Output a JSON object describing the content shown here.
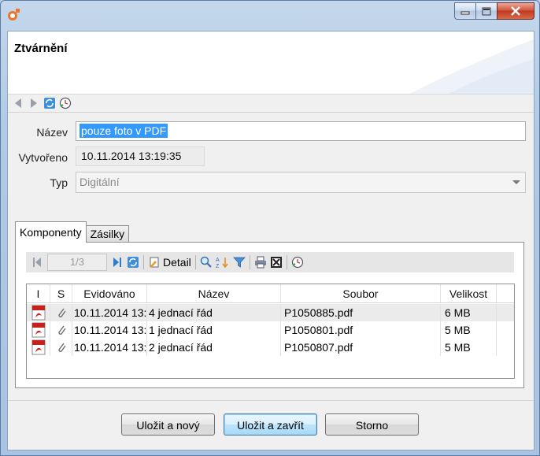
{
  "window": {
    "minimize_icon": "minimize-icon",
    "maximize_icon": "maximize-icon",
    "close_icon": "close-icon"
  },
  "header": {
    "title": "Ztvárnění"
  },
  "nav": {
    "icons": [
      "back-arrow-icon",
      "forward-arrow-icon",
      "refresh-icon",
      "history-icon"
    ]
  },
  "form": {
    "name_label": "Název",
    "name_value": "pouze foto v PDF",
    "created_label": "Vytvořeno",
    "created_value": "10.11.2014 13:19:35",
    "type_label": "Typ",
    "type_value": "Digitální"
  },
  "tabs": [
    {
      "label": "Komponenty",
      "active": true
    },
    {
      "label": "Zásilky",
      "active": false
    }
  ],
  "toolbar": {
    "page_indicator": "1/3",
    "detail_label": "Detail"
  },
  "grid": {
    "columns": [
      "I",
      "S",
      "Evidováno",
      "Název",
      "Soubor",
      "Velikost"
    ],
    "rows": [
      {
        "evidovano": "10.11.2014 13:",
        "nazev": "4 jednací řád",
        "soubor": "P1050885.pdf",
        "velikost": "6 MB",
        "selected": true
      },
      {
        "evidovano": "10.11.2014 13:",
        "nazev": "1 jednací řád",
        "soubor": "P1050801.pdf",
        "velikost": "5 MB",
        "selected": false
      },
      {
        "evidovano": "10.11.2014 13:",
        "nazev": "2 jednací řád",
        "soubor": "P1050807.pdf",
        "velikost": "5 MB",
        "selected": false
      }
    ]
  },
  "buttons": {
    "save_new": "Uložit a nový",
    "save_close": "Uložit a zavřít",
    "cancel": "Storno"
  },
  "colors": {
    "selection": "#3399ff",
    "pdf_red": "#c8201a",
    "accent_blue": "#2a6bbf"
  }
}
